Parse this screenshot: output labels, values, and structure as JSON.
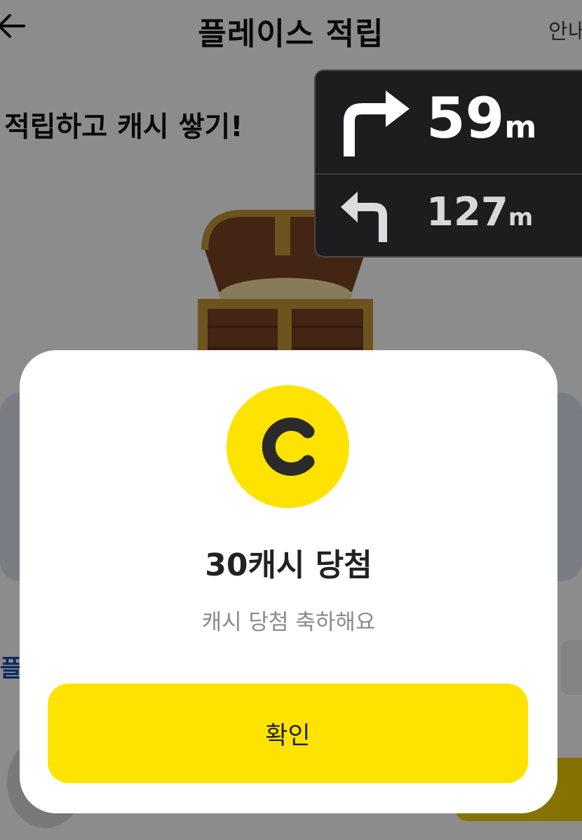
{
  "header": {
    "title": "플레이스 적립",
    "guide_label": "안내"
  },
  "main": {
    "headline": "적립하고 캐시 쌓기!",
    "blue_text": "플"
  },
  "navigation": {
    "next_turn": {
      "direction": "turn-right",
      "distance": "59",
      "unit": "m"
    },
    "following_turn": {
      "direction": "turn-left",
      "distance": "127",
      "unit": "m"
    }
  },
  "dialog": {
    "icon": "cash-coin-icon",
    "title": "30캐시 당첨",
    "subtitle": "캐시 당첨 축하해요",
    "confirm_label": "확인"
  },
  "colors": {
    "accent": "#FFE300",
    "nav_bg": "#1D1D1F",
    "overlay": "rgba(0,0,0,0.45)"
  }
}
